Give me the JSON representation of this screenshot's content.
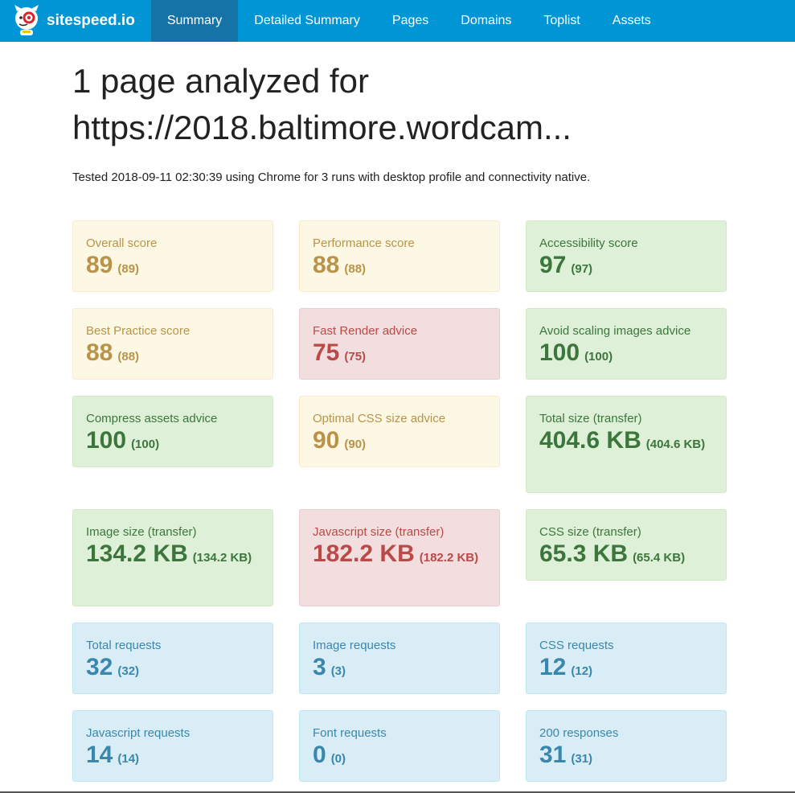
{
  "nav": {
    "brand": "sitespeed.io",
    "items": [
      "Summary",
      "Detailed Summary",
      "Pages",
      "Domains",
      "Toplist",
      "Assets"
    ],
    "active": "Summary"
  },
  "heading": {
    "line1": "1 page analyzed for",
    "line2": "https://2018.baltimore.wordcam..."
  },
  "tested": "Tested 2018-09-11 02:30:39 using Chrome for 3 runs with desktop profile and connectivity native.",
  "colors": {
    "navbar": "#0095d5",
    "nav_active": "#1673a8",
    "warning": "#b9934a",
    "danger": "#b94a48",
    "success": "#3c763d",
    "info": "#3a87ad"
  },
  "cards": [
    {
      "label": "Overall score",
      "value": "89",
      "sub": "(89)",
      "status": "warning"
    },
    {
      "label": "Performance score",
      "value": "88",
      "sub": "(88)",
      "status": "warning"
    },
    {
      "label": "Accessibility score",
      "value": "97",
      "sub": "(97)",
      "status": "success"
    },
    {
      "label": "Best Practice score",
      "value": "88",
      "sub": "(88)",
      "status": "warning"
    },
    {
      "label": "Fast Render advice",
      "value": "75",
      "sub": "(75)",
      "status": "danger"
    },
    {
      "label": "Avoid scaling images advice",
      "value": "100",
      "sub": "(100)",
      "status": "success"
    },
    {
      "label": "Compress assets advice",
      "value": "100",
      "sub": "(100)",
      "status": "success"
    },
    {
      "label": "Optimal CSS size advice",
      "value": "90",
      "sub": "(90)",
      "status": "warning"
    },
    {
      "label": "Total size (transfer)",
      "value": "404.6 KB",
      "sub": "(404.6 KB)",
      "status": "success"
    },
    {
      "label": "Image size (transfer)",
      "value": "134.2 KB",
      "sub": "(134.2 KB)",
      "status": "success"
    },
    {
      "label": "Javascript size (transfer)",
      "value": "182.2 KB",
      "sub": "(182.2 KB)",
      "status": "danger"
    },
    {
      "label": "CSS size (transfer)",
      "value": "65.3 KB",
      "sub": "(65.4 KB)",
      "status": "success"
    },
    {
      "label": "Total requests",
      "value": "32",
      "sub": "(32)",
      "status": "info"
    },
    {
      "label": "Image requests",
      "value": "3",
      "sub": "(3)",
      "status": "info"
    },
    {
      "label": "CSS requests",
      "value": "12",
      "sub": "(12)",
      "status": "info"
    },
    {
      "label": "Javascript requests",
      "value": "14",
      "sub": "(14)",
      "status": "info"
    },
    {
      "label": "Font requests",
      "value": "0",
      "sub": "(0)",
      "status": "info"
    },
    {
      "label": "200 responses",
      "value": "31",
      "sub": "(31)",
      "status": "info"
    }
  ]
}
